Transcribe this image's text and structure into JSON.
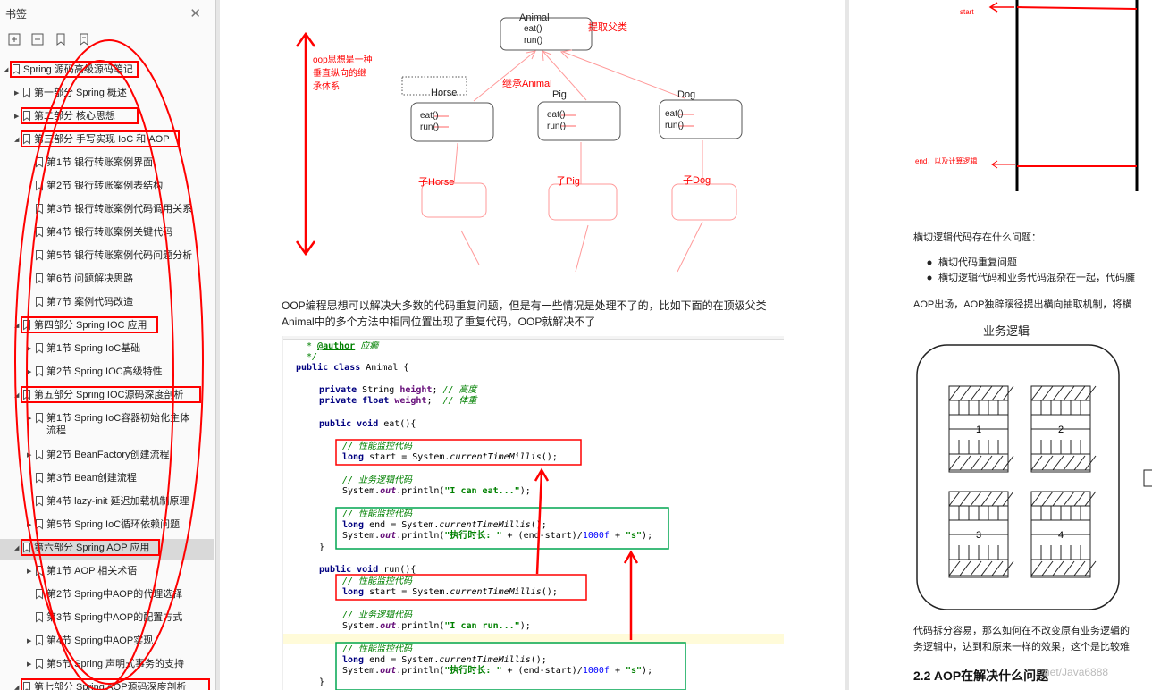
{
  "sidebar": {
    "title": "书签",
    "close_icon": "close-icon",
    "tools": [
      "expand-all-icon",
      "collapse-all-icon",
      "add-bookmark-icon",
      "bookmark-options-icon"
    ],
    "items": [
      {
        "label": "Spring 源码高级源码笔记",
        "level": 0,
        "twisty": "down"
      },
      {
        "label": "第一部分 Spring 概述",
        "level": 1,
        "twisty": "right"
      },
      {
        "label": "第二部分 核心思想",
        "level": 1,
        "twisty": "right"
      },
      {
        "label": "第三部分 手写实现 IoC 和 AOP",
        "level": 1,
        "twisty": "down"
      },
      {
        "label": "第1节 银行转账案例界面",
        "level": 2,
        "twisty": ""
      },
      {
        "label": "第2节 银行转账案例表结构",
        "level": 2,
        "twisty": ""
      },
      {
        "label": "第3节 银行转账案例代码调用关系",
        "level": 2,
        "twisty": ""
      },
      {
        "label": "第4节 银行转账案例关键代码",
        "level": 2,
        "twisty": ""
      },
      {
        "label": "第5节 银行转账案例代码问题分析",
        "level": 2,
        "twisty": ""
      },
      {
        "label": "第6节 问题解决思路",
        "level": 2,
        "twisty": ""
      },
      {
        "label": "第7节 案例代码改造",
        "level": 2,
        "twisty": ""
      },
      {
        "label": "第四部分 Spring IOC 应用",
        "level": 1,
        "twisty": "down"
      },
      {
        "label": "第1节 Spring IoC基础",
        "level": 2,
        "twisty": "right"
      },
      {
        "label": "第2节 Spring IOC高级特性",
        "level": 2,
        "twisty": "right"
      },
      {
        "label": "第五部分 Spring IOC源码深度剖析",
        "level": 1,
        "twisty": "down"
      },
      {
        "label": "第1节 Spring IoC容器初始化主体流程",
        "level": 2,
        "twisty": "right"
      },
      {
        "label": "第2节 BeanFactory创建流程",
        "level": 2,
        "twisty": "right"
      },
      {
        "label": "第3节 Bean创建流程",
        "level": 2,
        "twisty": ""
      },
      {
        "label": "第4节 lazy-init 延迟加载机制原理",
        "level": 2,
        "twisty": ""
      },
      {
        "label": "第5节 Spring IoC循环依赖问题",
        "level": 2,
        "twisty": "right"
      },
      {
        "label": "第六部分 Spring AOP 应用",
        "level": 1,
        "twisty": "down"
      },
      {
        "label": "第1节 AOP 相关术语",
        "level": 2,
        "twisty": "right"
      },
      {
        "label": "第2节 Spring中AOP的代理选择",
        "level": 2,
        "twisty": ""
      },
      {
        "label": "第3节 Spring中AOP的配置方式",
        "level": 2,
        "twisty": ""
      },
      {
        "label": "第4节 Spring中AOP实现",
        "level": 2,
        "twisty": "right"
      },
      {
        "label": "第5节 Spring 声明式事务的支持",
        "level": 2,
        "twisty": "right"
      },
      {
        "label": "第七部分 Spring AOP源码深度剖析",
        "level": 1,
        "twisty": "down"
      }
    ]
  },
  "diagram": {
    "side_note": [
      "oop思想是一种",
      "垂直纵向的继",
      "承体系"
    ],
    "parent_name": "Animal",
    "parent_methods": [
      "eat()",
      "run()"
    ],
    "extract_label": "提取父类",
    "inherit_label": "继承Animal",
    "children": [
      {
        "name": "Horse",
        "methods": [
          "eat()",
          "run()"
        ],
        "sub": "子Horse"
      },
      {
        "name": "Pig",
        "methods": [
          "eat()",
          "run()"
        ],
        "sub": "子Pig"
      },
      {
        "name": "Dog",
        "methods": [
          "eat()",
          "run()"
        ],
        "sub": "子Dog"
      }
    ]
  },
  "article": {
    "para1_line1": "OOP编程思想可以解决大多数的代码重复问题，但是有一些情况是处理不了的，比如下面的在顶级父类",
    "para1_line2": "Animal中的多个方法中相同位置出现了重复代码，OOP就解决不了"
  },
  "code": {
    "author_tag": "@author",
    "author_name": "应癫",
    "class_decl": "Animal {",
    "field1_type": "String",
    "field1_name": "height",
    "field1_comment": "// 高度",
    "field2_type": "float",
    "field2_name": "weight",
    "field2_comment": "// 体重",
    "eat_method": "eat(){",
    "run_method": "run(){",
    "perf_comment": "// 性能监控代码",
    "biz_comment": "// 业务逻辑代码",
    "start_line": "start = System.",
    "time_call": "currentTimeMillis",
    "time_tail": "();",
    "end_line": "end = System.",
    "eat_print": "\"I can eat...\"",
    "run_print": "\"I can run...\"",
    "elapsed_str": "\"执行时长: \"",
    "elapsed_mid": " + (end-start)/",
    "elapsed_num": "1000f",
    "elapsed_unit": "\"s\""
  },
  "right_page": {
    "start_label": "start",
    "end_label": "end，以及计算逻辑",
    "question": "横切逻辑代码存在什么问题：",
    "bullets": [
      "横切代码重复问题",
      "横切逻辑代码和业务代码混杂在一起，代码臃"
    ],
    "aop_line": "AOP出场，AOP独辟蹊径提出横向抽取机制，将横",
    "biz_title": "业务逻辑",
    "blocks": [
      "1",
      "2",
      "3",
      "4"
    ],
    "bottom_line1": "代码拆分容易，那么如何在不改变原有业务逻辑的",
    "bottom_line2": "务逻辑中，达到和原来一样的效果，这个是比较难",
    "section_title": "2.2 AOP在解决什么问题",
    "watermark": "net/Java6888"
  },
  "colors": {
    "annotation_red": "#ff0000",
    "code_green": "#00a651",
    "selection": "#d9d9d9"
  }
}
